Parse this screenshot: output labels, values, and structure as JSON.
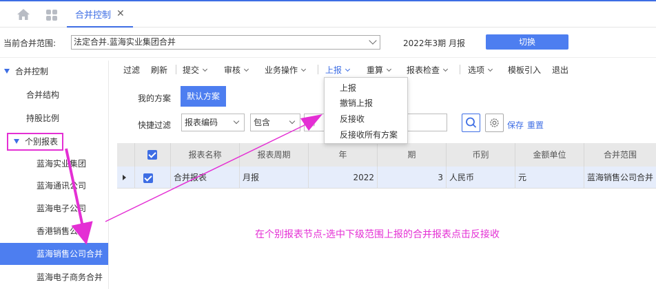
{
  "tab": {
    "label": "合并控制",
    "close": "✕"
  },
  "scope": {
    "label": "当前合并范围:",
    "value": "法定合并.蓝海实业集团合并",
    "period": "2022年3期  月报",
    "switch_label": "切换"
  },
  "sidebar": {
    "items": [
      {
        "label": "合并控制"
      },
      {
        "label": "合并结构"
      },
      {
        "label": "持股比例"
      },
      {
        "label": "个别报表"
      },
      {
        "label": "蓝海实业集团"
      },
      {
        "label": "蓝海通讯公司"
      },
      {
        "label": "蓝海电子公司"
      },
      {
        "label": "香港销售公司"
      },
      {
        "label": "蓝海销售公司合并"
      },
      {
        "label": "蓝海电子商务合并"
      }
    ]
  },
  "toolbar": {
    "filter": "过滤",
    "refresh": "刷新",
    "submit": "提交",
    "review": "审核",
    "business": "业务操作",
    "report_up": "上报",
    "recalc": "重算",
    "check": "报表检查",
    "options": "选项",
    "template_import": "模板引入",
    "exit": "退出"
  },
  "report_menu": {
    "items": [
      "上报",
      "撤销上报",
      "反接收",
      "反接收所有方案"
    ]
  },
  "plan": {
    "label": "我的方案",
    "default_label": "默认方案"
  },
  "quick_filter": {
    "label": "快捷过滤",
    "field": "报表编码",
    "operator": "包含",
    "placeholder": "请",
    "save": "保存",
    "reset": "重置"
  },
  "grid": {
    "columns": [
      "报表名称",
      "报表周期",
      "年",
      "期",
      "币别",
      "金额单位",
      "合并范围"
    ],
    "rows": [
      {
        "name": "合并报表",
        "cycle": "月报",
        "year": "2022",
        "period": "3",
        "currency": "人民币",
        "unit": "元",
        "scope": "蓝海销售公司合并"
      }
    ]
  },
  "annotation": "在个别报表节点-选中下级范围上报的合并报表点击反接收",
  "colors": {
    "accent": "#3d6de4",
    "annotation": "#e42fd4"
  }
}
